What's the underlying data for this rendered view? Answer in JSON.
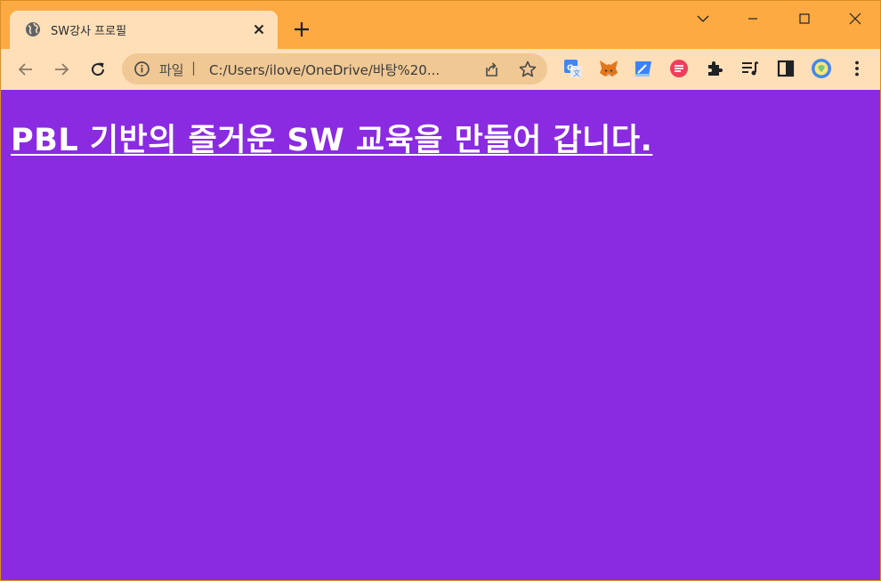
{
  "tab": {
    "title": "SW강사 프로필",
    "favicon": "globe-icon",
    "close_icon": "close-icon"
  },
  "window_controls": [
    "chevron-down-icon",
    "minimize-icon",
    "maximize-icon",
    "close-icon"
  ],
  "omnibox": {
    "scheme_label": "파일",
    "separator": "|",
    "url": "C:/Users/ilove/OneDrive/바탕%20..."
  },
  "extensions": [
    "translate-icon",
    "metamask-fox-icon",
    "bookmark-extension-icon",
    "stripe-extension-icon",
    "puzzle-icon",
    "media-queue-icon",
    "side-panel-icon",
    "profile-avatar-icon"
  ],
  "page": {
    "headline": "PBL 기반의 즐거운 SW 교육을 만들어 갑니다."
  },
  "colors": {
    "tabstrip": "#fdaa42",
    "toolbar": "#fedfb8",
    "omnibox": "#f0c894",
    "page_background": "#8a2be2",
    "headline": "#ffffff"
  }
}
